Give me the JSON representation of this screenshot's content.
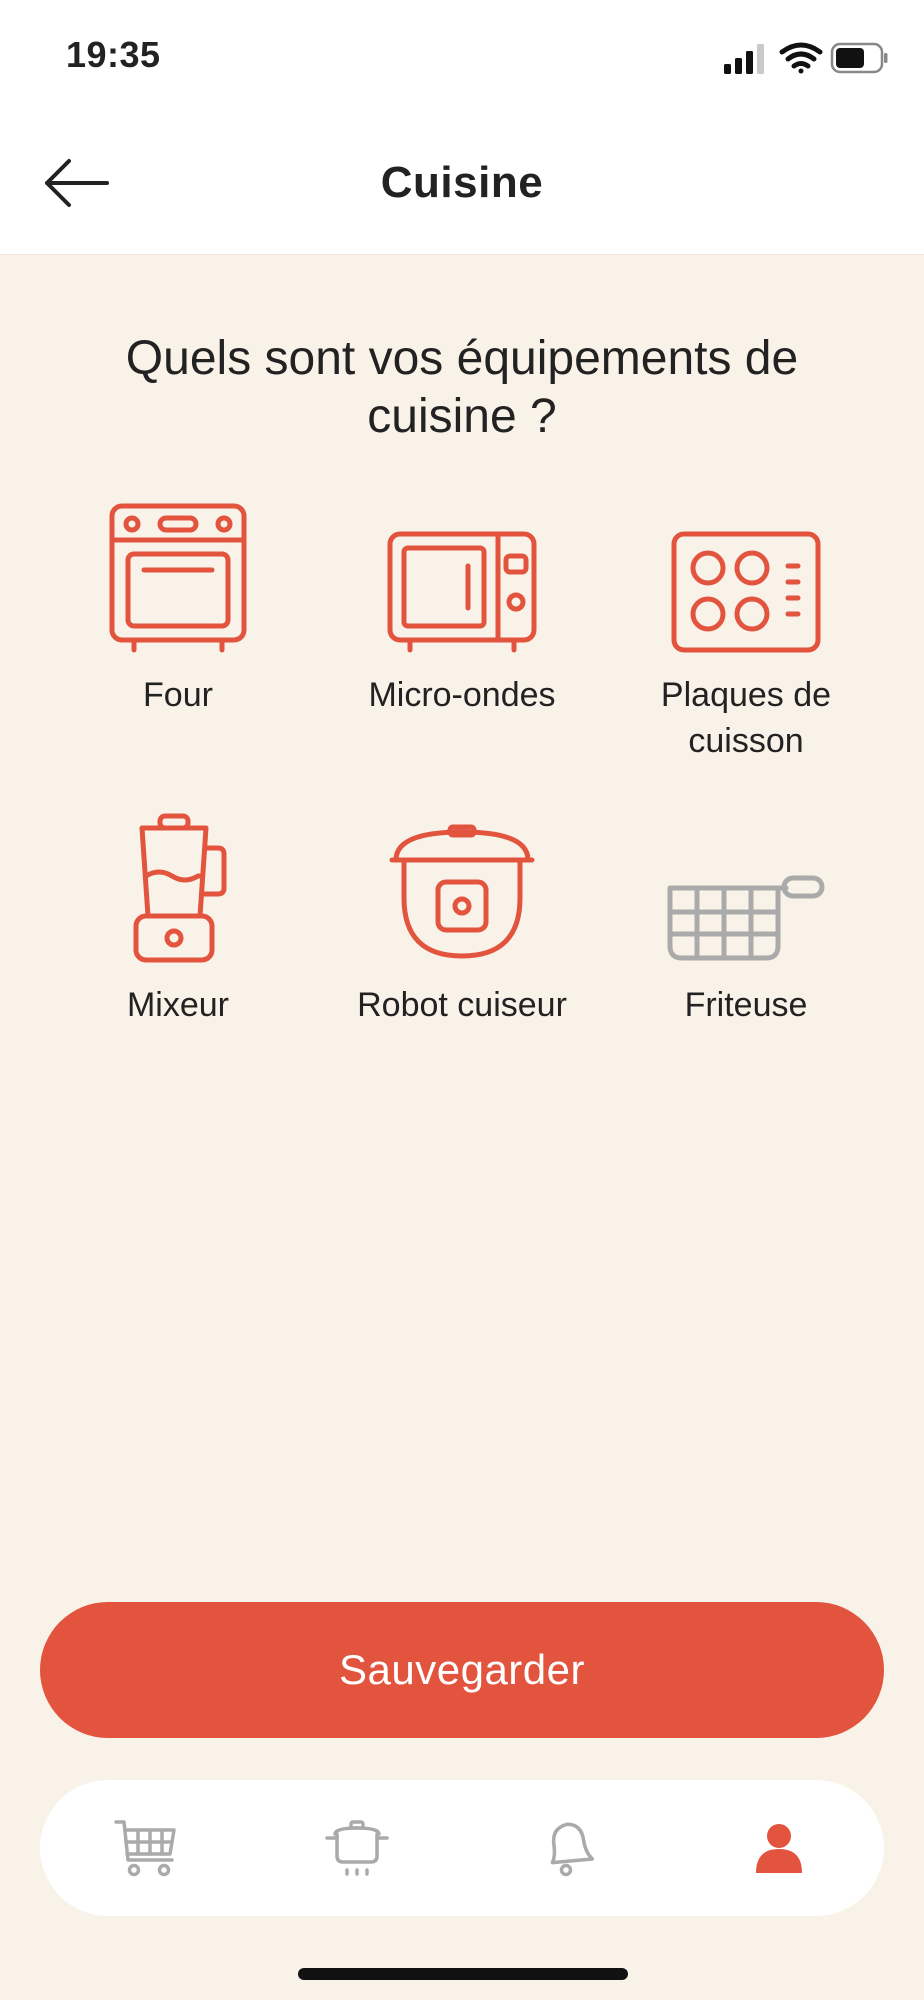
{
  "status_bar": {
    "time": "19:35"
  },
  "header": {
    "title": "Cuisine"
  },
  "question": "Quels sont vos équipements de cuisine ?",
  "colors": {
    "accent": "#e2543e",
    "inactive": "#aaaaaa",
    "background": "#f9f2e8"
  },
  "equipment": [
    {
      "label": "Four",
      "icon": "oven-icon",
      "selected": true
    },
    {
      "label": "Micro-ondes",
      "icon": "microwave-icon",
      "selected": true
    },
    {
      "label": "Plaques de cuisson",
      "icon": "cooktop-icon",
      "selected": true
    },
    {
      "label": "Mixeur",
      "icon": "blender-icon",
      "selected": true
    },
    {
      "label": "Robot cuiseur",
      "icon": "pressure-cooker-icon",
      "selected": true
    },
    {
      "label": "Friteuse",
      "icon": "fryer-basket-icon",
      "selected": false
    }
  ],
  "save_button": {
    "label": "Sauvegarder"
  },
  "tab_bar": {
    "tabs": [
      {
        "icon": "cart-icon",
        "active": false
      },
      {
        "icon": "pot-icon",
        "active": false
      },
      {
        "icon": "bell-icon",
        "active": false
      },
      {
        "icon": "profile-icon",
        "active": true
      }
    ]
  }
}
